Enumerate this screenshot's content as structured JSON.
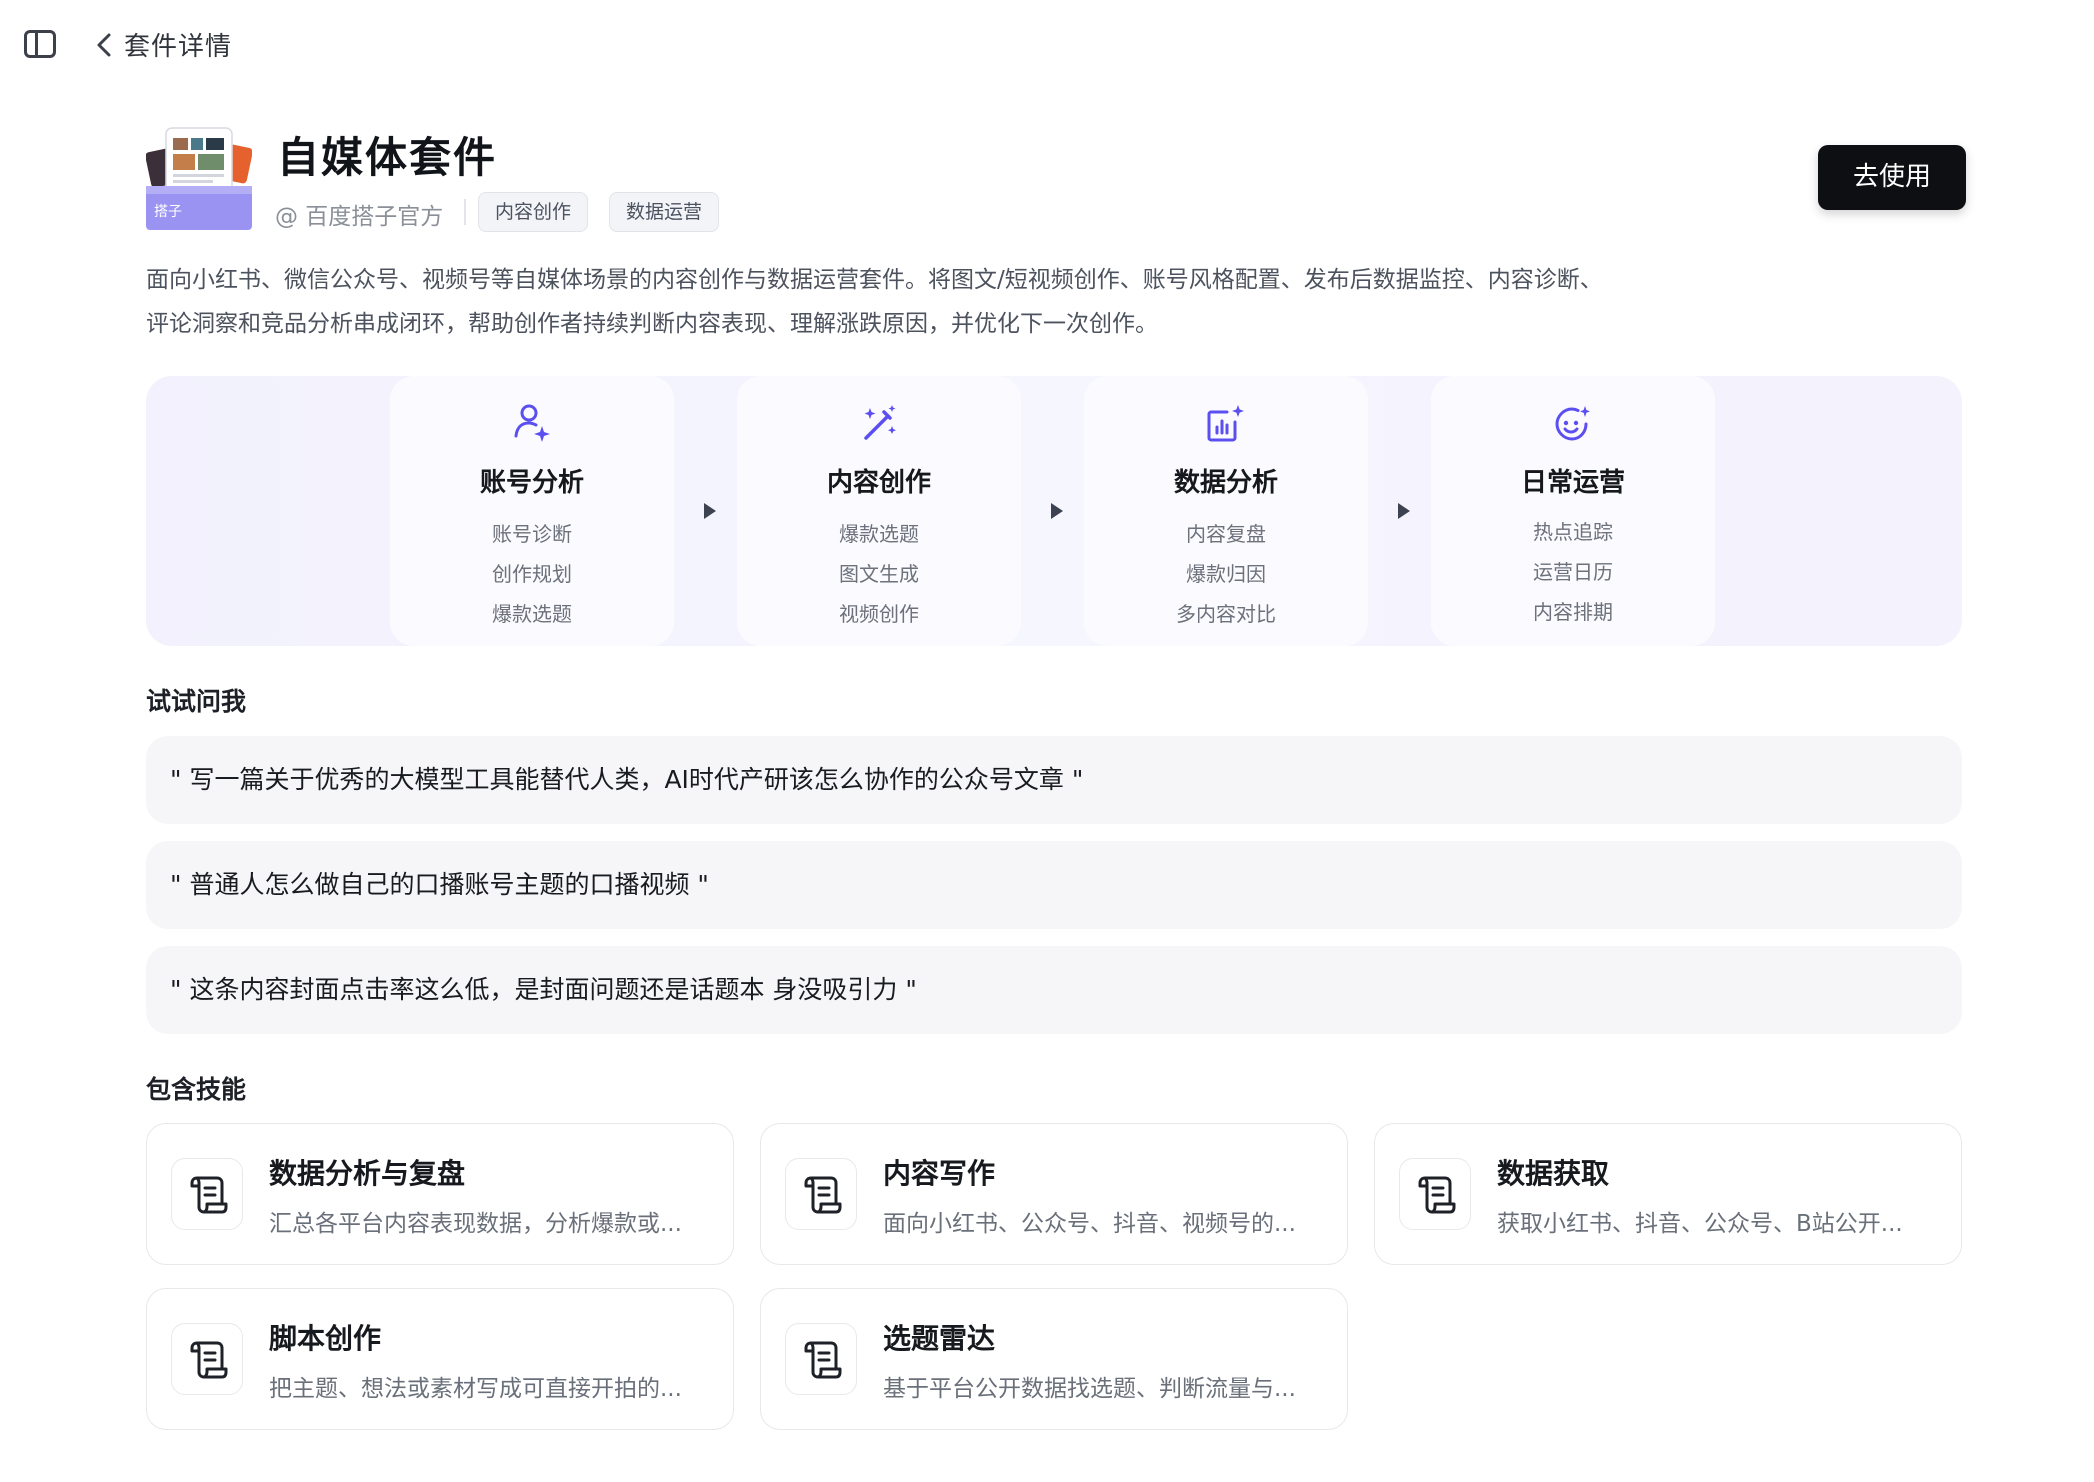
{
  "topbar": {
    "title": "套件详情"
  },
  "suite": {
    "name": "自媒体套件",
    "author": "@ 百度搭子官方",
    "logo_label": "搭子",
    "tags": [
      "内容创作",
      "数据运营"
    ],
    "use_button": "去使用",
    "description": "面向小红书、微信公众号、视频号等自媒体场景的内容创作与数据运营套件。将图文/短视频创作、账号风格配置、发布后数据监控、内容诊断、评论洞察和竞品分析串成闭环，帮助创作者持续判断内容表现、理解涨跌原因，并优化下一次创作。"
  },
  "workflow": {
    "stages": [
      {
        "icon": "user-sparkle-icon",
        "title": "账号分析",
        "items": [
          "账号诊断",
          "创作规划",
          "爆款选题"
        ]
      },
      {
        "icon": "magic-wand-icon",
        "title": "内容创作",
        "items": [
          "爆款选题",
          "图文生成",
          "视频创作"
        ]
      },
      {
        "icon": "chart-sparkle-icon",
        "title": "数据分析",
        "items": [
          "内容复盘",
          "爆款归因",
          "多内容对比"
        ]
      },
      {
        "icon": "smile-sparkle-icon",
        "title": "日常运营",
        "items": [
          "热点追踪",
          "运营日历",
          "内容排期"
        ]
      }
    ]
  },
  "try_ask": {
    "title": "试试问我",
    "prompts": [
      "\" 写一篇关于优秀的大模型工具能替代人类，AI时代产研该怎么协作的公众号文章 \"",
      "\" 普通人怎么做自己的口播账号主题的口播视频 \"",
      "\" 这条内容封面点击率这么低，是封面问题还是话题本 身没吸引力 \""
    ]
  },
  "skills": {
    "title": "包含技能",
    "items": [
      {
        "icon": "scroll-icon",
        "name": "数据分析与复盘",
        "desc": "汇总各平台内容表现数据，分析爆款或..."
      },
      {
        "icon": "scroll-icon",
        "name": "内容写作",
        "desc": "面向小红书、公众号、抖音、视频号的..."
      },
      {
        "icon": "scroll-icon",
        "name": "数据获取",
        "desc": "获取小红书、抖音、公众号、B站公开..."
      },
      {
        "icon": "scroll-icon",
        "name": "脚本创作",
        "desc": "把主题、想法或素材写成可直接开拍的..."
      },
      {
        "icon": "scroll-icon",
        "name": "选题雷达",
        "desc": "基于平台公开数据找选题、判断流量与..."
      }
    ]
  },
  "colors": {
    "accent": "#5b4ff0",
    "button": "#0d0f12",
    "workflow_bg": "#f3f2fd"
  }
}
